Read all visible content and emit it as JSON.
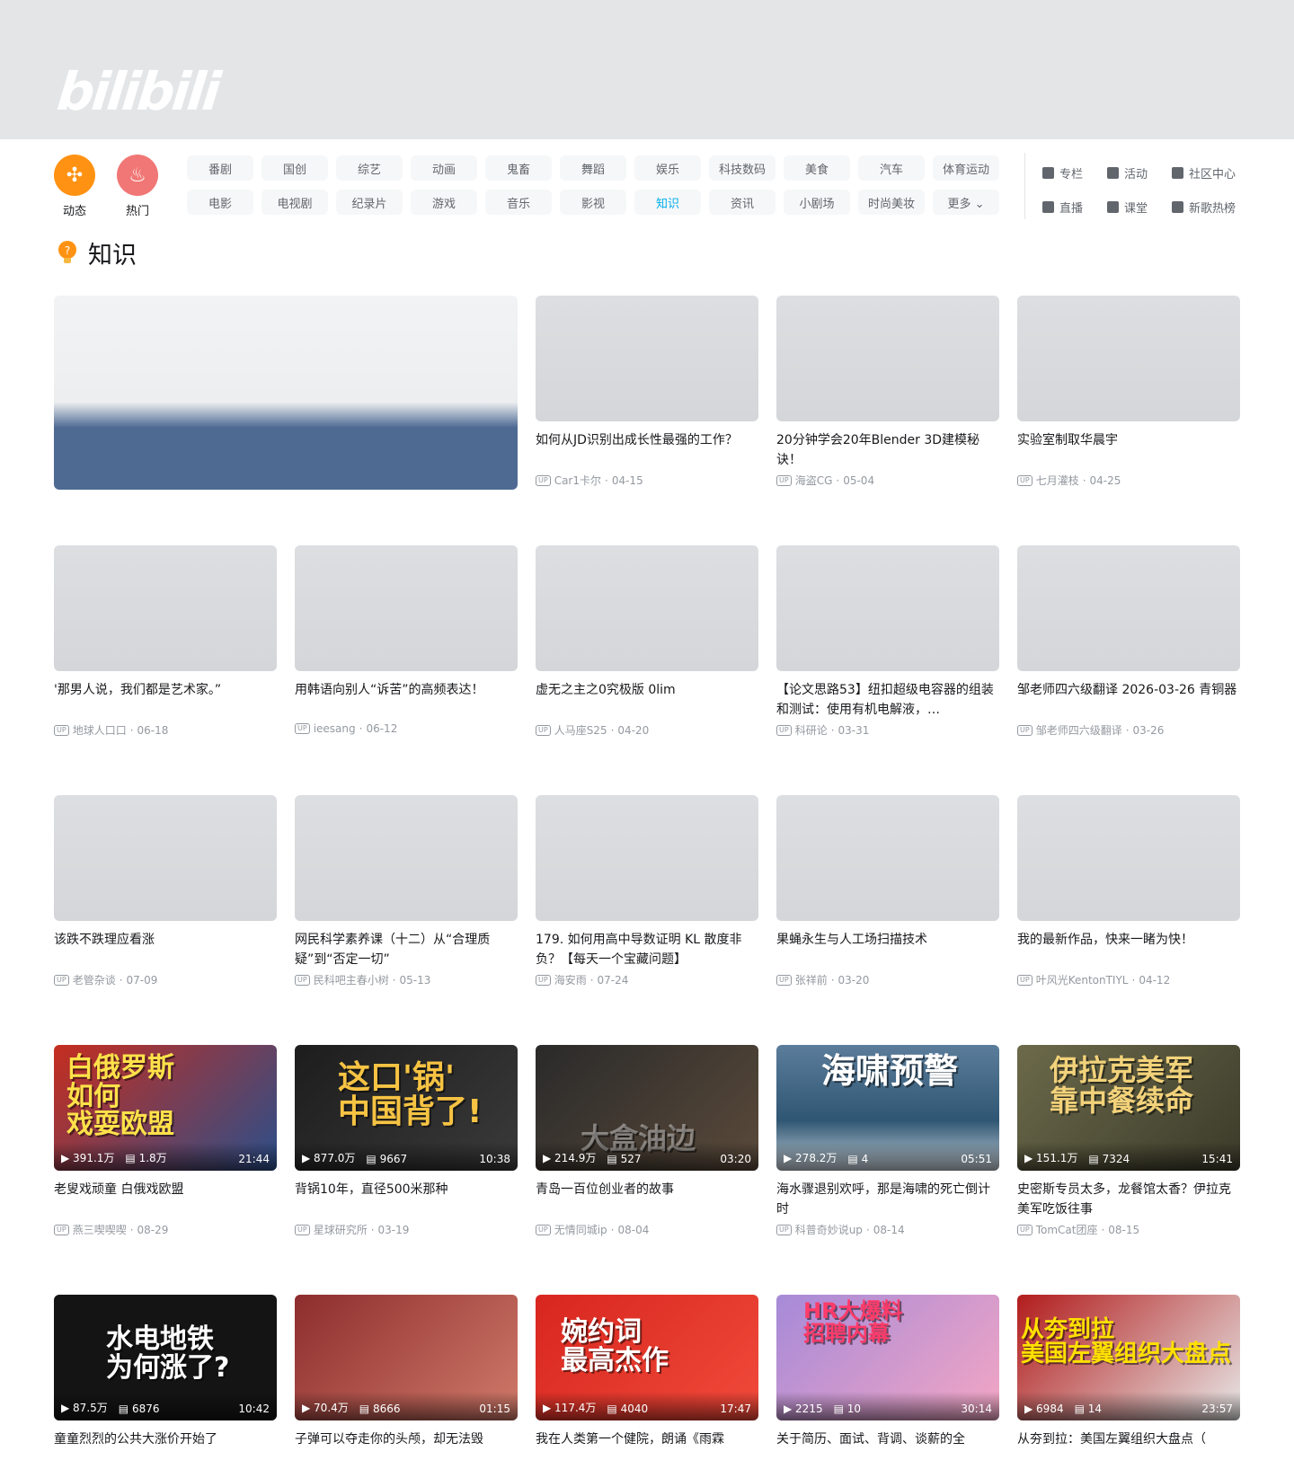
{
  "logo": "bilibili",
  "nav": {
    "dynamic": "动态",
    "hot": "热门",
    "channels_row1": [
      "番剧",
      "国创",
      "综艺",
      "动画",
      "鬼畜",
      "舞蹈",
      "娱乐",
      "科技数码",
      "美食",
      "汽车",
      "体育运动"
    ],
    "channels_row2": [
      "电影",
      "电视剧",
      "纪录片",
      "游戏",
      "音乐",
      "影视",
      "知识",
      "资讯",
      "小剧场",
      "时尚美妆",
      "更多 ⌄"
    ],
    "active_channel": "知识",
    "right_links": [
      "专栏",
      "活动",
      "社区中心",
      "直播",
      "课堂",
      "新歌热榜"
    ]
  },
  "section": {
    "title": "知识"
  },
  "cards": [
    {
      "title": "如何从JD识别出成长性最强的工作？",
      "up": "Car1卡尔",
      "date": "04-15"
    },
    {
      "title": "20分钟学会20年Blender 3D建模秘诀！",
      "up": "海盗CG",
      "date": "05-04"
    },
    {
      "title": "实验室制取华晨宇",
      "up": "七月灌枝",
      "date": "04-25"
    },
    {
      "title": "'那男人说，我们都是艺术家。”",
      "up": "地球人口口",
      "date": "06-18"
    },
    {
      "title": "用韩语向别人“诉苦”的高频表达！",
      "up": "ieesang",
      "date": "06-12"
    },
    {
      "title": "虚无之主之0究极版 0lim",
      "up": "人马座S25",
      "date": "04-20"
    },
    {
      "title": "【论文思路53】纽扣超级电容器的组装和测试：使用有机电解液，…",
      "up": "科研论",
      "date": "03-31"
    },
    {
      "title": "邹老师四六级翻译 2026-03-26 青铜器",
      "up": "邹老师四六级翻译",
      "date": "03-26"
    },
    {
      "title": "该跌不跌理应看涨",
      "up": "老管杂谈",
      "date": "07-09"
    },
    {
      "title": "网民科学素养课（十二）从“合理质疑”到“否定一切”",
      "up": "民科吧主春小树",
      "date": "05-13"
    },
    {
      "title": "179. 如何用高中导数证明 KL 散度非负？【每天一个宝藏问题】",
      "up": "海安雨",
      "date": "07-24"
    },
    {
      "title": "果蝇永生与人工场扫描技术",
      "up": "张祥前",
      "date": "03-20"
    },
    {
      "title": "我的最新作品，快来一睹为快！",
      "up": "叶风光KentonTIYL",
      "date": "04-12"
    },
    {
      "title": "老叟戏顽童 白俄戏欧盟",
      "up": "燕三喫喫喫",
      "date": "08-29",
      "views": "391.1万",
      "danmaku": "1.8万",
      "duration": "21:44",
      "thumb_text": "白俄罗斯\n如何\n戏耍欧盟"
    },
    {
      "title": "背锅10年，直径500米那种",
      "up": "星球研究所",
      "date": "03-19",
      "views": "877.0万",
      "danmaku": "9667",
      "duration": "10:38",
      "thumb_text": "这口'锅'\n中国背了!"
    },
    {
      "title": "青岛一百位创业者的故事",
      "up": "无情同城ip",
      "date": "08-04",
      "views": "214.9万",
      "danmaku": "527",
      "duration": "03:20",
      "thumb_text": "大盒油边"
    },
    {
      "title": "海水骤退别欢呼，那是海啸的死亡倒计时",
      "up": "科普奇妙说up",
      "date": "08-14",
      "views": "278.2万",
      "danmaku": "4",
      "duration": "05:51",
      "thumb_text": "海啸预警"
    },
    {
      "title": "史密斯专员太多，龙餐馆太香？伊拉克美军吃饭往事",
      "up": "TomCat团座",
      "date": "08-15",
      "views": "151.1万",
      "danmaku": "7324",
      "duration": "15:41",
      "thumb_text": "伊拉克美军\n靠中餐续命"
    },
    {
      "title": "童童烈烈的公共大涨价开始了",
      "up": "",
      "date": "",
      "views": "87.5万",
      "danmaku": "6876",
      "duration": "10:42",
      "thumb_text": "水电地铁\n为何涨了?"
    },
    {
      "title": "子弹可以夺走你的头颅，却无法毁",
      "up": "",
      "date": "",
      "views": "70.4万",
      "danmaku": "8666",
      "duration": "01:15",
      "thumb_text": ""
    },
    {
      "title": "我在人类第一个健院，朗诵《雨霖",
      "up": "",
      "date": "",
      "views": "117.4万",
      "danmaku": "4040",
      "duration": "17:47",
      "thumb_text": "婉约词\n最高杰作"
    },
    {
      "title": "关于简历、面试、背调、谈薪的全",
      "up": "",
      "date": "",
      "views": "2215",
      "danmaku": "10",
      "duration": "30:14",
      "thumb_text": "HR大爆料\n招聘内幕"
    },
    {
      "title": "从夯到拉：美国左翼组织大盘点（",
      "up": "",
      "date": "",
      "views": "6984",
      "danmaku": "14",
      "duration": "23:57",
      "thumb_text": "从夯到拉\n美国左翼组织大盘点"
    }
  ]
}
